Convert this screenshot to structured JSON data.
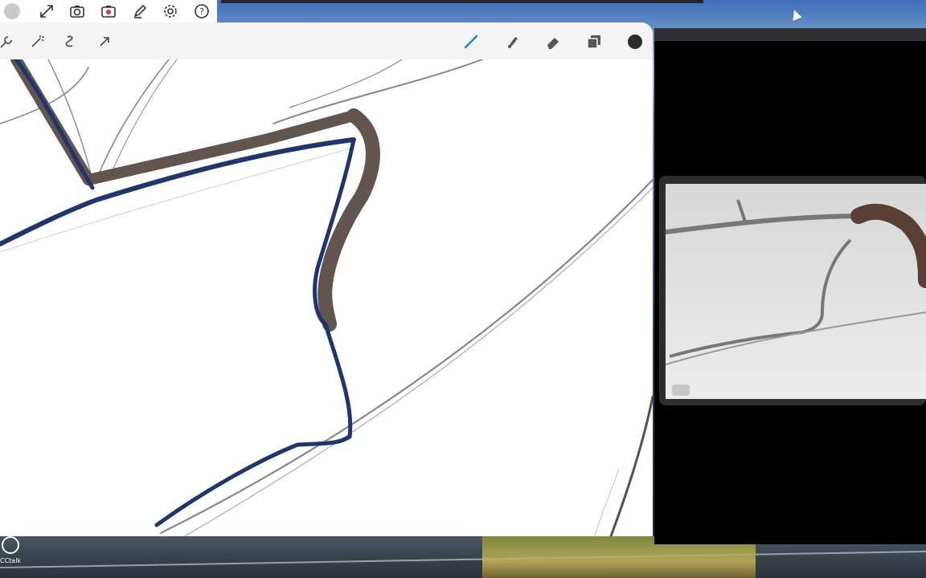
{
  "colors": {
    "accent": "#1a8bd6",
    "ink_blue": "#1f3570",
    "ink_brown": "#5a4b45",
    "pencil_gray": "#6a6a6a"
  },
  "top_toolbar": {
    "icons": [
      "avatar",
      "expand-icon",
      "camera-icon",
      "record-icon",
      "brush-edit-icon",
      "settings-icon",
      "help-icon"
    ]
  },
  "app_toolbar": {
    "left_icons": [
      "wrench-icon",
      "magic-wand-icon",
      "selection-icon",
      "transform-arrow-icon"
    ],
    "right_icons": [
      "brush-icon",
      "smudge-icon",
      "eraser-icon",
      "layers-icon",
      "color-swatch-icon"
    ],
    "active_tool": "brush-icon"
  },
  "watermark": {
    "text": "CCtalk"
  }
}
